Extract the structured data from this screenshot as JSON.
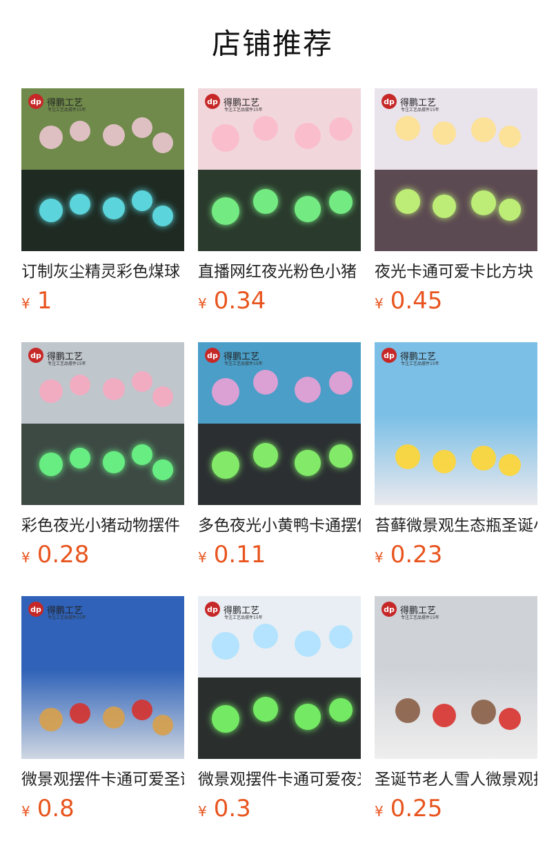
{
  "page_title": "店铺推荐",
  "logo": {
    "brand": "得鹏工艺",
    "mark": "dp",
    "tagline": "专注工艺品摆件15年"
  },
  "currency_symbol": "¥",
  "products": [
    {
      "name": "订制灰尘精灵彩色煤球",
      "price": "1",
      "image": {
        "top": "#6f8a4a",
        "bottom": "#1e2a22",
        "accent_top": "#f2c9d8",
        "accent_bottom": "#62e8f0"
      }
    },
    {
      "name": "直播网红夜光粉色小猪",
      "price": "0.34",
      "image": {
        "top": "#f1d7dc",
        "bottom": "#2a3a2c",
        "accent_top": "#fbb8c8",
        "accent_bottom": "#7dff8c"
      }
    },
    {
      "name": "夜光卡通可爱卡比方块",
      "price": "0.45",
      "image": {
        "top": "#e9e3ec",
        "bottom": "#5c4a52",
        "accent_top": "#ffe08a",
        "accent_bottom": "#c8ff7a"
      }
    },
    {
      "name": "彩色夜光小猪动物摆件",
      "price": "0.28",
      "image": {
        "top": "#bfc6cc",
        "bottom": "#3d4a44",
        "accent_top": "#f9a7c0",
        "accent_bottom": "#6dff8a"
      }
    },
    {
      "name": "多色夜光小黄鸭卡通摆件",
      "price": "0.11",
      "image": {
        "top": "#4a9ec7",
        "bottom": "#2b2f32",
        "accent_top": "#f4a0d6",
        "accent_bottom": "#8cff6e"
      }
    },
    {
      "name": "苔藓微景观生态瓶圣诞小黄鸭",
      "price": "0.23",
      "image": {
        "top": "#7bbfe6",
        "bottom": "#e9e9ee",
        "accent_top": "#ffd633",
        "accent_bottom": "#ffd633"
      }
    },
    {
      "name": "微景观摆件卡通可爱圣诞",
      "price": "0.8",
      "image": {
        "top": "#2f62b8",
        "bottom": "#cfd7e2",
        "accent_top": "#d8a04a",
        "accent_bottom": "#d6322e"
      }
    },
    {
      "name": "微景观摆件卡通可爱夜光鸭",
      "price": "0.3",
      "image": {
        "top": "#e8eef4",
        "bottom": "#2a2f2e",
        "accent_top": "#a9e0ff",
        "accent_bottom": "#7dff6a"
      }
    },
    {
      "name": "圣诞节老人雪人微景观摆件",
      "price": "0.25",
      "image": {
        "top": "#cfd3d8",
        "bottom": "#efeeee",
        "accent_top": "#8a5e46",
        "accent_bottom": "#d8322e"
      }
    }
  ]
}
